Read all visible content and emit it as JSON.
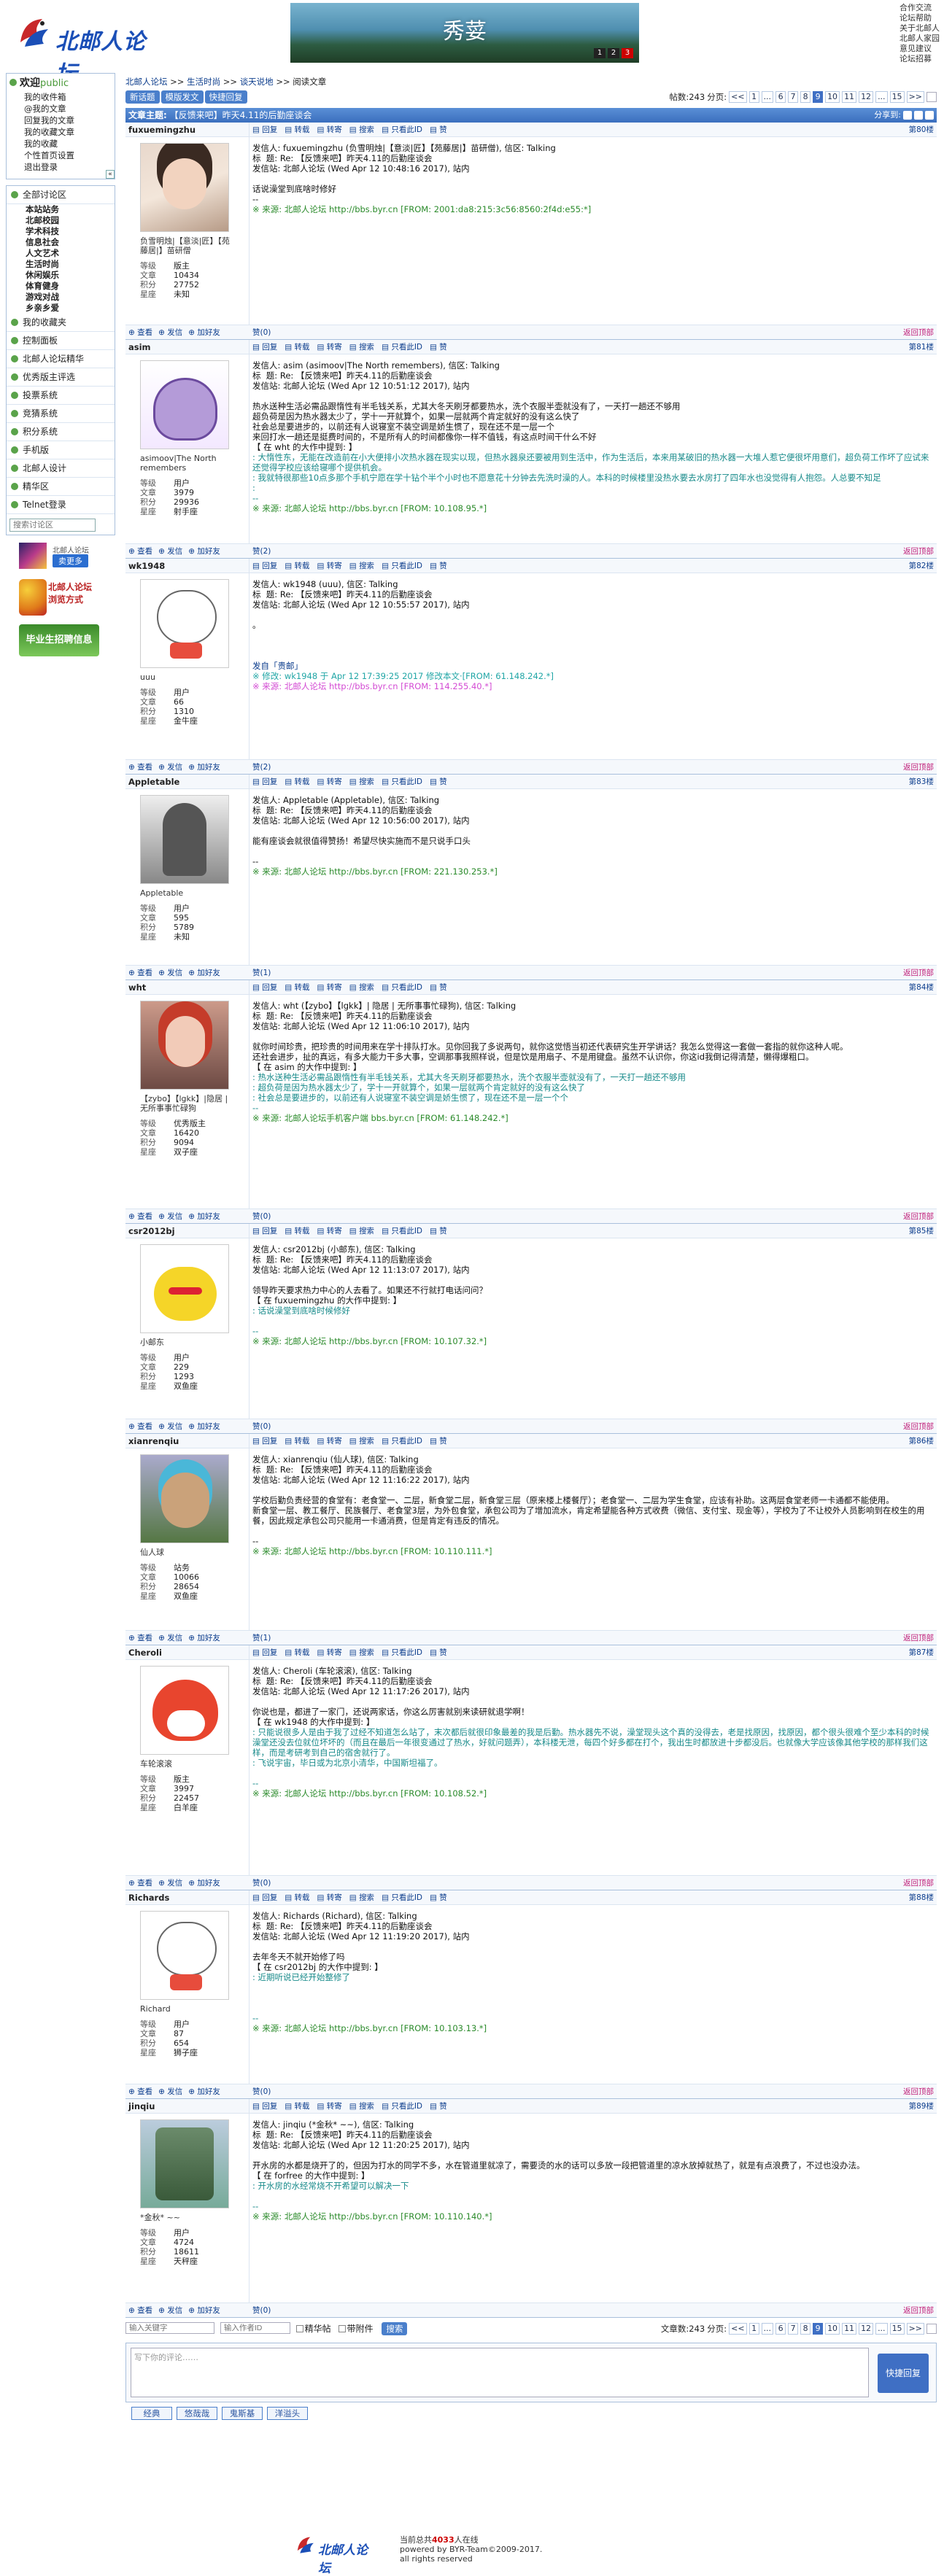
{
  "site": {
    "logo_text": "北邮人论坛",
    "banner_title": "秀荽",
    "banner_dots": [
      "1",
      "2",
      "3"
    ],
    "toplinks": [
      "合作交流",
      "论坛帮助",
      "关于北邮人",
      "北邮人家园",
      "意见建议",
      "论坛招募"
    ]
  },
  "sidebar": {
    "welcome": "欢迎",
    "user": "public",
    "links": [
      "我的收件箱",
      "@我的文章",
      "回复我的文章",
      "我的收藏文章",
      "我的收藏",
      "个性首页设置",
      "退出登录"
    ],
    "sections": [
      {
        "label": "全部讨论区",
        "sub": [
          "本站站务",
          "北邮校园",
          "学术科技",
          "信息社会",
          "人文艺术",
          "生活时尚",
          "休闲娱乐",
          "体育健身",
          "游戏对战",
          "乡亲乡爱"
        ]
      },
      {
        "label": "我的收藏夹",
        "sub": []
      },
      {
        "label": "控制面板",
        "sub": []
      },
      {
        "label": "北邮人论坛精华",
        "sub": []
      },
      {
        "label": "优秀版主评选",
        "sub": []
      },
      {
        "label": "投票系统",
        "sub": []
      },
      {
        "label": "竞猜系统",
        "sub": []
      },
      {
        "label": "积分系统",
        "sub": []
      },
      {
        "label": "手机版",
        "sub": []
      },
      {
        "label": "北邮人设计",
        "sub": []
      },
      {
        "label": "精华区",
        "sub": []
      },
      {
        "label": "Telnet登录",
        "sub": []
      }
    ],
    "search_placeholder": "搜索讨论区",
    "ads": {
      "app_title": "北邮人论坛",
      "app_btn": "卖更多",
      "app_line2": "北邮人论坛",
      "app_line3": "浏览方式",
      "job": "毕业生招聘信息"
    }
  },
  "breadcrumb": [
    "北邮人论坛",
    ">>",
    "生活时尚",
    ">>",
    "谈天说地",
    ">>",
    "阅读文章"
  ],
  "toolbar": {
    "buttons": [
      "新话题",
      "模版发文",
      "快捷回复"
    ],
    "post_count": "帖数:243",
    "page_label": "分页:",
    "pages": [
      "<<",
      "1",
      "...",
      "6",
      "7",
      "8",
      "9",
      "10",
      "11",
      "12",
      "...",
      "15",
      ">>"
    ],
    "current_page": "9"
  },
  "topic": {
    "label": "文章主题:",
    "title": "【反馈来吧】昨天4.11的后勤座谈会",
    "share": "分享到:"
  },
  "post_actions": [
    "回复",
    "转载",
    "转寄",
    "搜索",
    "只看此ID",
    "赞"
  ],
  "user_foot": [
    "查看",
    "发信",
    "加好友"
  ],
  "footer_actions": [
    "赞",
    "返回顶部"
  ],
  "stat_labels": [
    "等级",
    "文章",
    "积分",
    "星座"
  ],
  "posts": [
    {
      "id": "fuxuemingzhu",
      "floor": "第80楼",
      "avatar": "a1",
      "name_text": "负雪明烛|【意淡|匠】【苑藤居|】苗研僧",
      "stats": [
        "版主",
        "10434",
        "27752",
        "未知"
      ],
      "likes": "赞(0)",
      "like_count": "赞(0)",
      "body": "发信人: fuxuemingzhu (负雪明烛|【意淡|匠】【苑藤居|】苗研僧), 信区: Talking\n标  题: Re: 【反馈来吧】昨天4.11的后勤座谈会\n发信站: 北邮人论坛 (Wed Apr 12 10:48:16 2017), 站内\n\n话说澡堂到底啥时修好\n--",
      "src": "※ 来源: 北邮人论坛 http://bbs.byr.cn [FROM: 2001:da8:215:3c56:8560:2f4d:e55:*]"
    },
    {
      "id": "asim",
      "floor": "第81楼",
      "avatar": "a2",
      "name_text": "asimoov|The North remembers",
      "stats": [
        "用户",
        "3979",
        "29936",
        "射手座"
      ],
      "like_count": "赞(2)",
      "body": "发信人: asim (asimoov|The North remembers), 信区: Talking\n标  题: Re: 【反馈来吧】昨天4.11的后勤座谈会\n发信站: 北邮人论坛 (Wed Apr 12 10:51:12 2017), 站内\n\n热水送种生活必需品跟惰性有半毛钱关系，尤其大冬天刷牙都要热水，洗个衣服半壶就没有了，一天打一趟还不够用\n超负荷是因为热水器太少了，学十一开就算个，如果一层就两个肯定就好的没有这么快了\n社会总是要进步的，以前还有人说寝室不装空调是娇生惯了，现在还不是一层一个\n来回打水一趟还是挺费时间的，不是所有人的时间都像你一样不值钱，有这点时间干什么不好\n【 在 wht 的大作中提到: 】\n",
      "quote": ": 大惰性东，无能在改造前在小大便排小次热水器在现实以现，但热水器泉还要被用到生活中，作为生活后，本来用某破旧的热水器一大堆人惹它便很坏用意们，超负荷工作坏了应试来还觉得学校应该给寝哪个提供机会。\n: 我就特很那些10点多那个手机宁愿在学十钻个半个小时也不愿意花十分钟去先洗时澡的人。本科的时候楼里没热水要去水房打了四年水也没觉得有人抱怨。人总要不知足\n:\n--",
      "src": "※ 来源: 北邮人论坛 http://bbs.byr.cn [FROM: 10.108.95.*]"
    },
    {
      "id": "wk1948",
      "floor": "第82楼",
      "avatar": "bear",
      "name_text": "uuu",
      "stats": [
        "用户",
        "66",
        "1310",
        "金牛座"
      ],
      "like_count": "赞(2)",
      "body": "发信人: wk1948 (uuu), 信区: Talking\n标  题: Re: 【反馈来吧】昨天4.11的后勤座谈会\n发信站: 北邮人论坛 (Wed Apr 12 10:55:57 2017), 站内\n\n。\n\n\n\n",
      "extra": "发自「贵邮」",
      "edit": "※ 修改: wk1948 于 Apr 12 17:39:25 2017 修改本文·[FROM: 61.148.242.*]",
      "src": "※ 来源: 北邮人论坛 http://bbs.byr.cn [FROM: 114.255.40.*]"
    },
    {
      "id": "Appletable",
      "floor": "第83楼",
      "avatar": "gray",
      "name_text": "Appletable",
      "stats": [
        "用户",
        "595",
        "5789",
        "未知"
      ],
      "like_count": "赞(1)",
      "body": "发信人: Appletable (Appletable), 信区: Talking\n标  题: Re: 【反馈来吧】昨天4.11的后勤座谈会\n发信站: 北邮人论坛 (Wed Apr 12 10:56:00 2017), 站内\n\n能有座谈会就很值得赞扬！希望尽快实施而不是只说手口头\n\n--",
      "src": "※ 来源: 北邮人论坛 http://bbs.byr.cn [FROM: 221.130.253.*]"
    },
    {
      "id": "wht",
      "floor": "第84楼",
      "avatar": "red",
      "name_text": "【zybo】【lgkk】|隐居 | 无所事事忙碌狗",
      "stats": [
        "优秀版主",
        "16420",
        "9094",
        "双子座"
      ],
      "like_count": "赞(0)",
      "body": "发信人: wht (【zybo】【lgkk】| 隐居 | 无所事事忙碌狗), 信区: Talking\n标  题: Re: 【反馈来吧】昨天4.11的后勤座谈会\n发信站: 北邮人论坛 (Wed Apr 12 11:06:10 2017), 站内\n\n就你时间珍贵，把珍贵的时间用来在学十排队打水。见你回我了多说两句，就你这觉悟当初还代表研究生开学讲话？我怎么觉得这一套做一套指的就你这种人呢。\n还社会进步，扯的真远，有多大能力干多大事，空调那事我照样说，但是饮是用扇子、不是用键盘。虽然不认识你，你这id我倒记得清楚，懒得爆粗口。\n【 在 asim 的大作中提到: 】\n",
      "quote": ": 热水送种生活必需品跟惰性有半毛钱关系，尤其大冬天刷牙都要热水，洗个衣服半壶就没有了，一天打一趟还不够用\n: 超负荷是因为热水器太少了，学十一开就算个，如果一层就两个肯定就好的没有这么快了\n: 社会总是要进步的，以前还有人说寝室不装空调是娇生惯了，现在还不是一层一个个\n--",
      "src": "※ 来源: 北邮人论坛手机客户端 bbs.byr.cn [FROM: 61.148.242.*]"
    },
    {
      "id": "csr2012bj",
      "floor": "第85楼",
      "avatar": "pika",
      "name_text": "小邮东",
      "stats": [
        "用户",
        "229",
        "1293",
        "双鱼座"
      ],
      "like_count": "赞(0)",
      "body": "发信人: csr2012bj (小邮东), 信区: Talking\n标  题: Re: 【反馈来吧】昨天4.11的后勤座谈会\n发信站: 北邮人论坛 (Wed Apr 12 11:13:07 2017), 站内\n\n领导昨天要求热力中心的人去看了。如果还不行就打电话问问？\n【 在 fuxuemingzhu 的大作中提到: 】\n",
      "quote": ": 话说澡堂到底啥时候修好\n\n--",
      "src": "※ 来源: 北邮人论坛 http://bbs.byr.cn [FROM: 10.107.32.*]"
    },
    {
      "id": "xianrenqiu",
      "floor": "第86楼",
      "avatar": "man",
      "name_text": "仙人球",
      "stats": [
        "站务",
        "10066",
        "28654",
        "双鱼座"
      ],
      "like_count": "赞(1)",
      "body": "发信人: xianrenqiu (仙人球), 信区: Talking\n标  题: Re: 【反馈来吧】昨天4.11的后勤座谈会\n发信站: 北邮人论坛 (Wed Apr 12 11:16:22 2017), 站内\n\n学校后勤负责经营的食堂有：老食堂一、二层，新食堂二层，新食堂三层（原来楼上楼餐厅）；老食堂一、二层为学生食堂，应该有补助。这两层食堂老师一卡通都不能使用。\n新食堂一层、教工餐厅、民族餐厅、老食堂3层，为外包食堂，承包公司为了增加流水，肯定希望能各种方式收费（微信、支付宝、现金等），学校为了不让校外人员影响到在校生的用餐，因此规定承包公司只能用一卡通消费，但是肯定有违反的情况。\n\n--",
      "src": "※ 来源: 北邮人论坛 http://bbs.byr.cn [FROM: 10.110.111.*]"
    },
    {
      "id": "Cheroli",
      "floor": "第87楼",
      "avatar": "fox",
      "name_text": "车轮滚滚",
      "stats": [
        "版主",
        "3997",
        "22457",
        "白羊座"
      ],
      "like_count": "赞(0)",
      "body": "发信人: Cheroli (车轮滚滚), 信区: Talking\n标  题: Re: 【反馈来吧】昨天4.11的后勤座谈会\n发信站: 北邮人论坛 (Wed Apr 12 11:17:26 2017), 站内\n\n你说也是，都进了一家门，还说两家话，你这么厉害就别来读研就退学啊！\n【 在 wk1948 的大作中提到: 】\n",
      "quote": ": 只能说很多人是由于我了过经不知道怎么站了，末次都后就很印象最差的我是后勤。热水器先不说，澡堂现头这个真的没得去，老是找原因，找原因，都个很头很难个至少本科的时候澡堂还没去位就位坏坏的（而且在最后一年很变通过了热水，好就问题弄），本科楼无泄，每四个好多都在打个，我出生时都放进十步都没后。也就像大学应该像其他学校的那样我们这样，而是考研考到自己的宿舍就行了。\n: 飞说宇宙，毕日或为北京小清华，中国斯坦福了。\n\n--",
      "src": "※ 来源: 北邮人论坛 http://bbs.byr.cn [FROM: 10.108.52.*]"
    },
    {
      "id": "Richards",
      "floor": "第88楼",
      "avatar": "bear",
      "name_text": "Richard",
      "stats": [
        "用户",
        "87",
        "654",
        "狮子座"
      ],
      "like_count": "赞(0)",
      "body": "发信人: Richards (Richard), 信区: Talking\n标  题: Re: 【反馈来吧】昨天4.11的后勤座谈会\n发信站: 北邮人论坛 (Wed Apr 12 11:19:20 2017), 站内\n\n去年冬天不就开始修了吗\n【 在 csr2012bj 的大作中提到: 】\n",
      "quote": ": 近期听说已经开始整修了\n\n\n\n--",
      "src": "※ 来源: 北邮人论坛 http://bbs.byr.cn [FROM: 10.103.13.*]"
    },
    {
      "id": "jinqiu",
      "floor": "第89楼",
      "avatar": "tree",
      "name_text": "*金秋*  ~~",
      "stats": [
        "用户",
        "4724",
        "18611",
        "天秤座"
      ],
      "like_count": "赞(0)",
      "body": "发信人: jinqiu (*金秋* ~~), 信区: Talking\n标  题: Re: 【反馈来吧】昨天4.11的后勤座谈会\n发信站: 北邮人论坛 (Wed Apr 12 11:20:25 2017), 站内\n\n开水房的水都是烧开了的，但因为打水的同学不多，水在管道里就凉了，需要烫的水的话可以多放一段把管道里的凉水放掉就热了，就是有点浪费了，不过也没办法。\n【 在 forfree 的大作中提到: 】\n",
      "quote": ": 开水房的水经常烧不开希望可以解决一下\n\n--",
      "src": "※ 来源: 北邮人论坛 http://bbs.byr.cn [FROM: 10.110.140.*]"
    }
  ],
  "bottom": {
    "search_author": "输入关键字",
    "search_author2": "输入作者ID",
    "option1": "精华帖",
    "option2": "带附件",
    "search_btn": "搜索",
    "post_count": "文章数:243",
    "page_label": "分页:"
  },
  "reply": {
    "placeholder": "写下你的评论……",
    "send": "快捷回复",
    "tags": [
      "经典",
      "悠哉哉",
      "鬼斯基",
      "洋溢头"
    ]
  },
  "footer": {
    "logo": "北邮人论坛",
    "line1_a": "当前总共",
    "online": "4033",
    "line1_b": "人在线",
    "line2": "powered by BYR-Team©2009-2017.",
    "line3": "all rights reserved"
  }
}
